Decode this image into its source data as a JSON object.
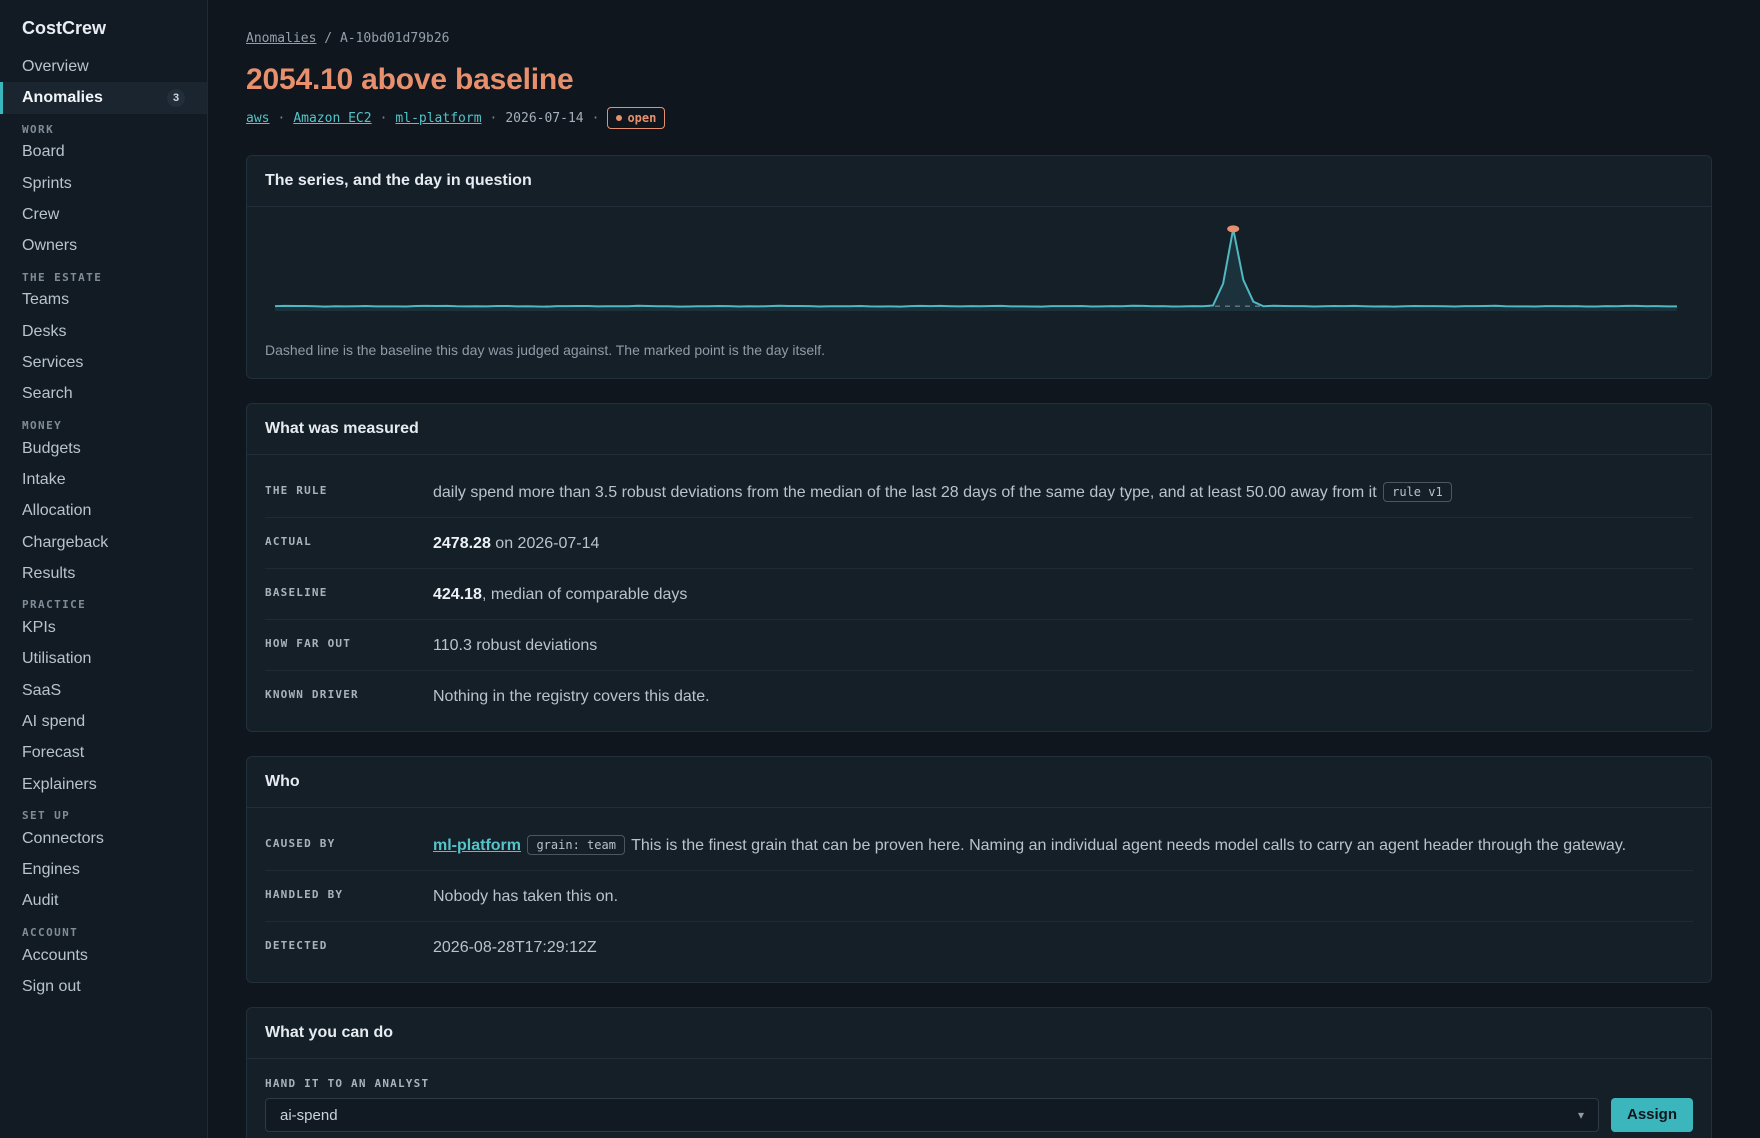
{
  "app": {
    "brand": "CostCrew"
  },
  "sidebar": {
    "top": [
      {
        "label": "Overview"
      },
      {
        "label": "Anomalies",
        "count": "3",
        "active": true
      }
    ],
    "sections": [
      {
        "title": "WORK",
        "items": [
          "Board",
          "Sprints",
          "Crew",
          "Owners"
        ]
      },
      {
        "title": "THE ESTATE",
        "items": [
          "Teams",
          "Desks",
          "Services",
          "Search"
        ]
      },
      {
        "title": "MONEY",
        "items": [
          "Budgets",
          "Intake",
          "Allocation",
          "Chargeback",
          "Results"
        ]
      },
      {
        "title": "PRACTICE",
        "items": [
          "KPIs",
          "Utilisation",
          "SaaS",
          "AI spend",
          "Forecast",
          "Explainers"
        ]
      },
      {
        "title": "SET UP",
        "items": [
          "Connectors",
          "Engines",
          "Audit"
        ]
      },
      {
        "title": "ACCOUNT",
        "items": [
          "Accounts",
          "Sign out"
        ]
      }
    ]
  },
  "breadcrumb": {
    "parent": "Anomalies",
    "sep": "/",
    "current": "A-10bd01d79b26"
  },
  "header": {
    "title": "2054.10 above baseline",
    "provider": "aws",
    "service": "Amazon EC2",
    "team": "ml-platform",
    "date": "2026-07-14",
    "status": "open",
    "sep": "·"
  },
  "series_card": {
    "title": "The series, and the day in question",
    "caption": "Dashed line is the baseline this day was judged against. The marked point is the day itself."
  },
  "chart_data": {
    "type": "line",
    "baseline": 424.18,
    "marked_point": {
      "date": "2026-07-14",
      "value": 2478.28
    },
    "colors": {
      "line": "#4fb8c0",
      "marker": "#e8906d",
      "baseline": "#6d7885"
    }
  },
  "measured_card": {
    "title": "What was measured",
    "rule_key": "THE RULE",
    "rule_text": "daily spend more than 3.5 robust deviations from the median of the last 28 days of the same day type, and at least 50.00 away from it",
    "rule_chip": "rule v1",
    "actual_key": "ACTUAL",
    "actual_value": "2478.28",
    "actual_suffix": "on 2026-07-14",
    "baseline_key": "BASELINE",
    "baseline_value": "424.18",
    "baseline_suffix": ", median of comparable days",
    "howfar_key": "HOW FAR OUT",
    "howfar_value": "110.3 robust deviations",
    "driver_key": "KNOWN DRIVER",
    "driver_value": "Nothing in the registry covers this date."
  },
  "who_card": {
    "title": "Who",
    "caused_key": "CAUSED BY",
    "caused_link": "ml-platform",
    "caused_chip": "grain: team",
    "caused_text": "This is the finest grain that can be proven here. Naming an individual agent needs model calls to carry an agent header through the gateway.",
    "handled_key": "HANDLED BY",
    "handled_value": "Nobody has taken this on.",
    "detected_key": "DETECTED",
    "detected_value": "2026-08-28T17:29:12Z"
  },
  "actions_card": {
    "title": "What you can do",
    "hand_label": "HAND IT TO AN ANALYST",
    "analyst_value": "ai-spend",
    "assign_label": "Assign"
  }
}
